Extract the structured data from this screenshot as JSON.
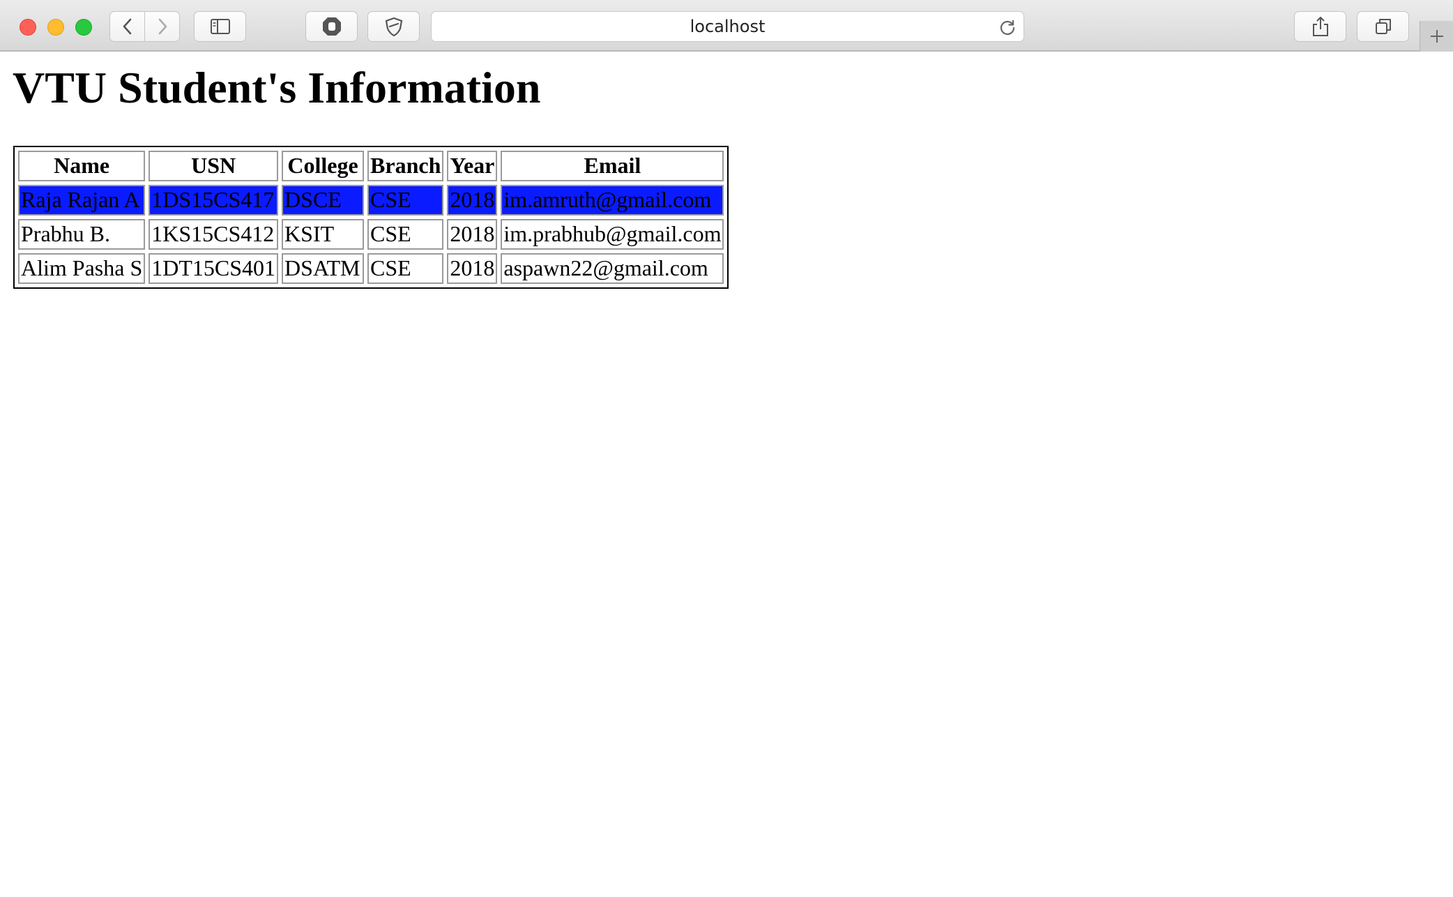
{
  "browser": {
    "url": "localhost"
  },
  "page": {
    "title": "VTU Student's Information"
  },
  "table": {
    "headers": [
      "Name",
      "USN",
      "College",
      "Branch",
      "Year",
      "Email"
    ],
    "highlight_color": "#0a1bff",
    "rows": [
      [
        "Raja Rajan A",
        "1DS15CS417",
        "DSCE",
        "CSE",
        "2018",
        "im.amruth@gmail.com"
      ],
      [
        "Prabhu B.",
        "1KS15CS412",
        "KSIT",
        "CSE",
        "2018",
        "im.prabhub@gmail.com"
      ],
      [
        "Alim Pasha S",
        "1DT15CS401",
        "DSATM",
        "CSE",
        "2018",
        "aspawn22@gmail.com"
      ]
    ]
  },
  "icons": {
    "close": "close-window-icon",
    "minimize": "minimize-window-icon",
    "zoom": "zoom-window-icon",
    "back": "chevron-left-icon",
    "forward": "chevron-right-icon",
    "sidebar": "sidebar-icon",
    "extension1": "hand-stop-icon",
    "extension2": "shield-icon",
    "reload": "reload-icon",
    "share": "share-icon",
    "tabs": "tabs-overview-icon",
    "new_tab": "plus-icon"
  }
}
